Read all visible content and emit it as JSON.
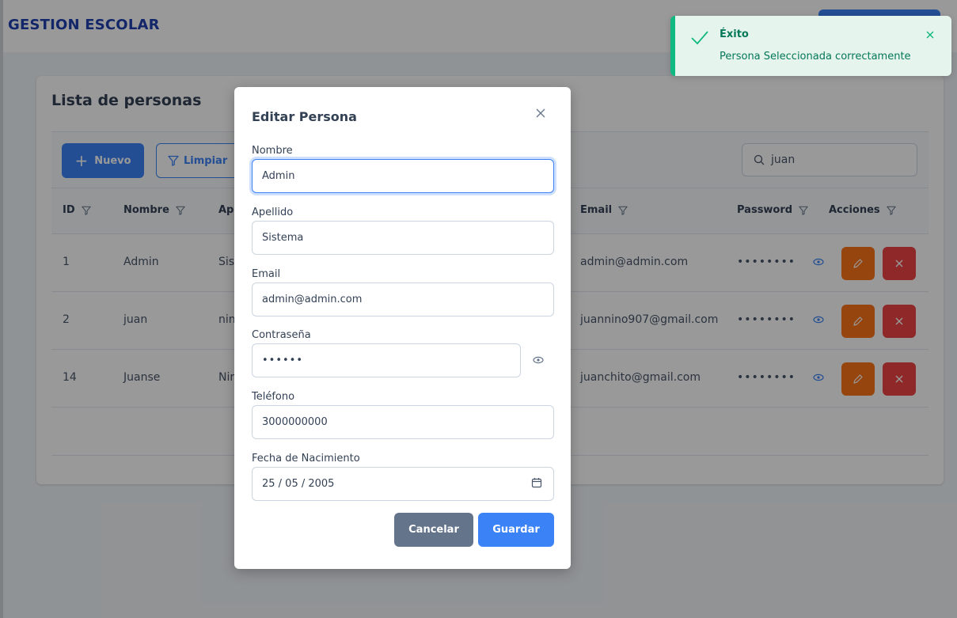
{
  "app": {
    "title": "GESTION ESCOLAR"
  },
  "card": {
    "title": "Lista de personas"
  },
  "toolbar": {
    "new_label": "Nuevo",
    "clear_label": "Limpiar",
    "search_value": "juan"
  },
  "table": {
    "headers": {
      "id": "ID",
      "nombre": "Nombre",
      "apellido": "Ap",
      "email": "Email",
      "password": "Password",
      "acciones": "Acciones"
    },
    "rows": [
      {
        "id": "1",
        "nombre": "Admin",
        "apellido": "Sist",
        "email": "admin@admin.com",
        "password": "••••••••"
      },
      {
        "id": "2",
        "nombre": "juan",
        "apellido": "nin",
        "email": "juannino907@gmail.com",
        "password": "••••••••"
      },
      {
        "id": "14",
        "nombre": "Juanse",
        "apellido": "Nir",
        "email": "juanchito@gmail.com",
        "password": "••••••••"
      }
    ]
  },
  "toast": {
    "title": "Éxito",
    "message": "Persona Seleccionada correctamente"
  },
  "dialog": {
    "title": "Editar Persona",
    "fields": {
      "nombre": {
        "label": "Nombre",
        "value": "Admin"
      },
      "apellido": {
        "label": "Apellido",
        "value": "Sistema"
      },
      "email": {
        "label": "Email",
        "value": "admin@admin.com"
      },
      "password": {
        "label": "Contraseña",
        "value": "••••••"
      },
      "telefono": {
        "label": "Teléfono",
        "value": "3000000000"
      },
      "fecha": {
        "label": "Fecha de Nacimiento",
        "value": "25 / 05 / 2005"
      }
    },
    "cancel_label": "Cancelar",
    "save_label": "Guardar"
  },
  "colors": {
    "primary": "#3b82f6",
    "brand": "#1e40af",
    "edit": "#f97316",
    "delete": "#ef4444",
    "success": "#10b981",
    "secondary": "#64748b"
  },
  "icons": [
    "plus-icon",
    "filter-icon",
    "search-icon",
    "eye-icon",
    "pencil-icon",
    "x-icon",
    "check-icon",
    "close-icon",
    "calendar-icon"
  ]
}
